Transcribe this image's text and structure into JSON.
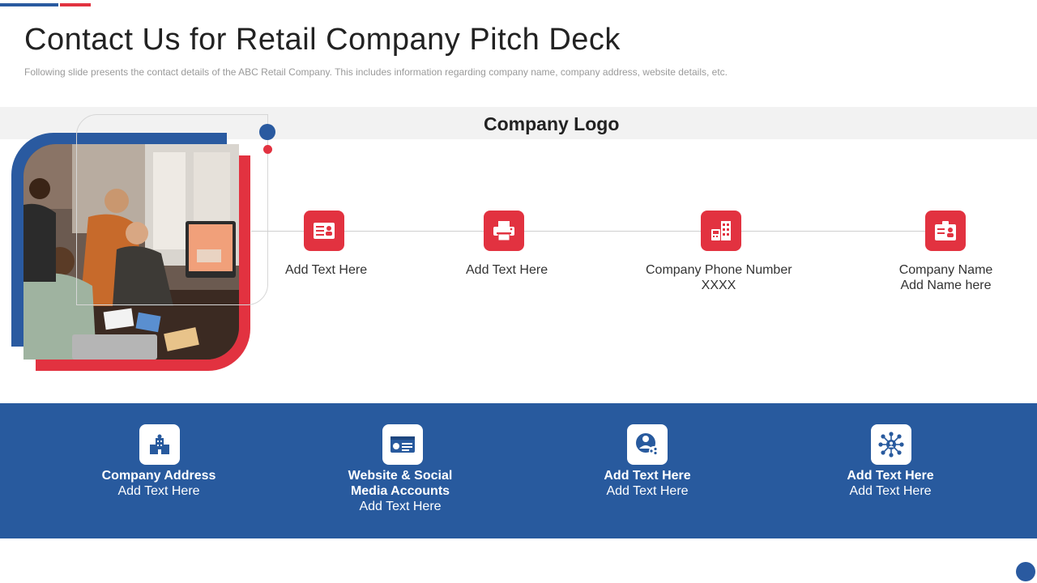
{
  "header": {
    "title": "Contact Us for Retail Company Pitch Deck",
    "subtitle": "Following slide presents the contact details of the ABC Retail Company. This includes information regarding company name, company address, website details, etc."
  },
  "logo_band": {
    "label": "Company Logo"
  },
  "timeline": [
    {
      "icon": "id-card-icon",
      "lines": [
        "Add Text Here"
      ]
    },
    {
      "icon": "printer-icon",
      "lines": [
        "Add Text Here"
      ]
    },
    {
      "icon": "building-phone-icon",
      "lines": [
        "Company Phone Number",
        "XXXX"
      ]
    },
    {
      "icon": "badge-icon",
      "lines": [
        "Company Name",
        "Add Name here"
      ]
    }
  ],
  "bottom": [
    {
      "icon": "office-building-icon",
      "bold": [
        "Company Address"
      ],
      "normal": [
        "Add Text Here"
      ]
    },
    {
      "icon": "website-card-icon",
      "bold": [
        "Website & Social",
        "Media Accounts"
      ],
      "normal": [
        "Add Text Here"
      ]
    },
    {
      "icon": "user-network-icon",
      "bold": [
        "Add Text Here"
      ],
      "normal": [
        "Add Text Here"
      ]
    },
    {
      "icon": "hub-network-icon",
      "bold": [
        "Add Text Here"
      ],
      "normal": [
        "Add Text Here"
      ]
    }
  ],
  "colors": {
    "accent_blue": "#2a5aa0",
    "accent_red": "#e23240",
    "band_blue": "#285a9e",
    "logo_band_gray": "#f2f2f2"
  }
}
